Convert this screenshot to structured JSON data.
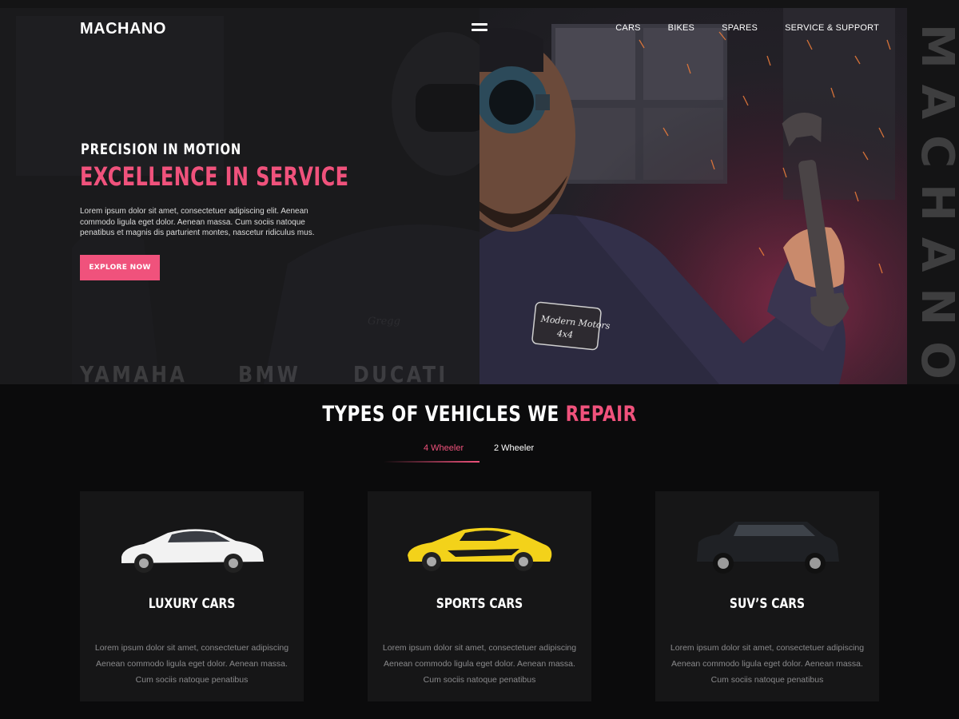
{
  "header": {
    "logo": "MACHANO",
    "nav": [
      "CARS",
      "BIKES",
      "SPARES",
      "SERVICE & SUPPORT"
    ]
  },
  "hero": {
    "kicker": "PRECISION IN MOTION",
    "title": "EXCELLENCE IN SERVICE",
    "text": "Lorem ipsum dolor sit amet, consectetuer adipiscing elit. Aenean commodo ligula eget dolor. Aenean massa. Cum sociis natoque penatibus et magnis dis parturient montes, nascetur ridiculus mus.",
    "cta": "EXPLORE NOW",
    "brands": [
      "YAMAHA",
      "BMW",
      "DUCATI"
    ],
    "vertical_brand": "MACHANO",
    "patch_text": [
      "Modern Motors",
      "4x4"
    ],
    "ghost_name": "Gregg"
  },
  "section": {
    "title_plain": "TYPES OF VEHICLES WE ",
    "title_accent": "REPAIR",
    "tabs": [
      "4 Wheeler",
      "2 Wheeler"
    ],
    "active_tab": "4 Wheeler"
  },
  "cards": [
    {
      "title": "LUXURY CARS",
      "lines": [
        "Lorem ipsum dolor sit amet, consectetuer adipiscing",
        "Aenean commodo ligula eget dolor. Aenean massa.",
        "Cum sociis natoque penatibus"
      ],
      "car_color": "#f2f2f2"
    },
    {
      "title": "SPORTS CARS",
      "lines": [
        "Lorem ipsum dolor sit amet, consectetuer adipiscing",
        "Aenean commodo ligula eget dolor. Aenean massa.",
        "Cum sociis natoque penatibus"
      ],
      "car_color": "#f3d21a"
    },
    {
      "title": "SUV’S CARS",
      "lines": [
        "Lorem ipsum dolor sit amet, consectetuer adipiscing",
        "Aenean commodo ligula eget dolor. Aenean massa.",
        "Cum sociis natoque penatibus"
      ],
      "car_color": "#1f2125"
    }
  ],
  "colors": {
    "accent": "#f0527c",
    "background": "#0b0b0c",
    "card": "#161617"
  }
}
